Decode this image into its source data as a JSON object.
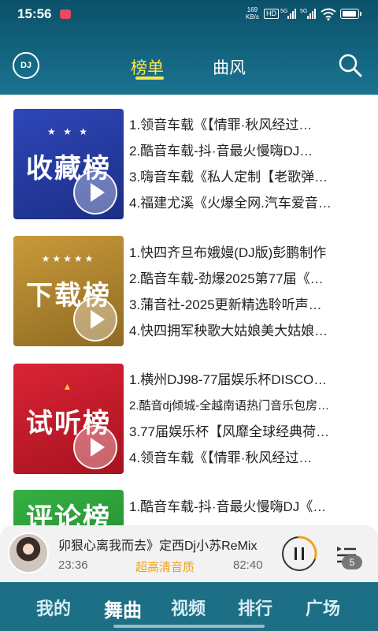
{
  "status_bar": {
    "time": "15:56",
    "speed_top": "169",
    "speed_unit": "KB/s",
    "hd": "HD",
    "net1": "5G",
    "net2": "5G"
  },
  "header": {
    "dj_label": "DJ",
    "tabs": [
      {
        "label": "榜单",
        "active": true
      },
      {
        "label": "曲风",
        "active": false
      }
    ]
  },
  "charts": [
    {
      "cover_title": "收藏榜",
      "color": "#2a3fa3",
      "items": [
        "1.领音车载《【情罪·秋风经过…",
        "2.酷音车载-抖·音最火慢嗨DJ…",
        "3.嗨音车载《私人定制【老歌弹…",
        "4.福建尤溪《火爆全网.汽车爱音…"
      ]
    },
    {
      "cover_title": "下载榜",
      "color": "#b8862a",
      "items": [
        "1.快四齐旦布娥嫚(DJ版)彭鹏制作",
        "2.酷音车载-劲爆2025第77届《…",
        "3.蒲音社-2025更新精选聆听声…",
        "4.快四拥军秧歌大姑娘美大姑娘…"
      ]
    },
    {
      "cover_title": "试听榜",
      "color": "#c81b2e",
      "items": [
        "1.横州DJ98-77届娱乐杯DISCO…",
        "2.酷音dj倾城-全越南语热门音乐包房…",
        "3.77届娱乐杯【风靡全球经典荷…",
        "4.领音车载《【情罪·秋风经过…"
      ]
    },
    {
      "cover_title": "评论榜",
      "color": "#2e9a3a",
      "items": [
        "1.酷音车载-抖·音最火慢嗨DJ《…"
      ]
    }
  ],
  "player": {
    "song": "卯狠心离我而去》定西Dj小苏ReMix",
    "current_time": "23:36",
    "quality": "超高清音质",
    "total_time": "82:40",
    "queue_count": "5",
    "progress": 0.29
  },
  "bottom_nav": [
    {
      "label": "我的",
      "active": false
    },
    {
      "label": "舞曲",
      "active": true
    },
    {
      "label": "视频",
      "active": false
    },
    {
      "label": "排行",
      "active": false
    },
    {
      "label": "广场",
      "active": false
    }
  ]
}
